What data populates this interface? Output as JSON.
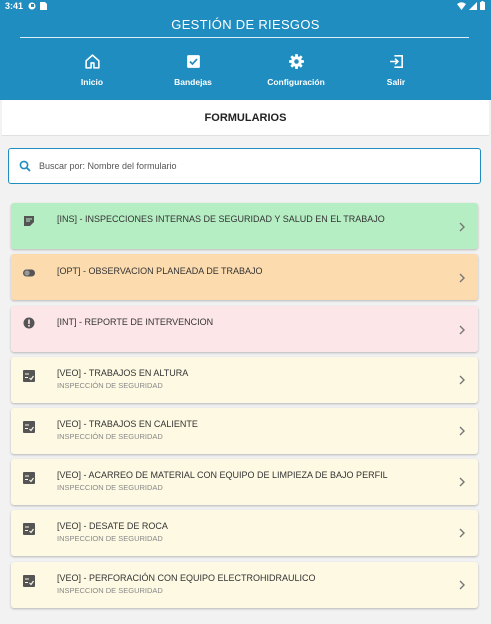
{
  "status_bar": {
    "time": "3:41"
  },
  "app": {
    "title": "GESTIÓN DE RIESGOS"
  },
  "nav": [
    {
      "label": "Inicio",
      "icon": "home-icon"
    },
    {
      "label": "Bandejas",
      "icon": "check-box-icon"
    },
    {
      "label": "Configuración",
      "icon": "gear-icon"
    },
    {
      "label": "Salir",
      "icon": "exit-icon"
    }
  ],
  "section": {
    "title": "FORMULARIOS"
  },
  "search": {
    "placeholder": "Buscar por: Nombre del formulario",
    "value": ""
  },
  "colors": {
    "primary": "#1f8dc0",
    "card_green": "#b6eec4",
    "card_orange": "#fcdcaf",
    "card_pink": "#fde6e8",
    "card_cream": "#fdf9e3"
  },
  "forms": [
    {
      "title": "[INS] - INSPECCIONES INTERNAS DE SEGURIDAD Y SALUD EN EL TRABAJO",
      "subtitle": "",
      "icon": "note-icon",
      "color": "green"
    },
    {
      "title": "[OPT] - OBSERVACION PLANEADA DE TRABAJO",
      "subtitle": "",
      "icon": "toggle-icon",
      "color": "orange"
    },
    {
      "title": "[INT] - REPORTE DE INTERVENCION",
      "subtitle": "",
      "icon": "alert-icon",
      "color": "pink"
    },
    {
      "title": "[VEO] -  TRABAJOS EN ALTURA",
      "subtitle": "INSPECCIÓN DE SEGURIDAD",
      "icon": "checklist-icon",
      "color": "cream"
    },
    {
      "title": "[VEO] -  TRABAJOS EN CALIENTE",
      "subtitle": "INSPECCIÓN DE SEGURIDAD",
      "icon": "checklist-icon",
      "color": "cream"
    },
    {
      "title": "[VEO] - ACARREO DE MATERIAL CON EQUIPO DE LIMPIEZA DE BAJO PERFIL",
      "subtitle": "INSPECCION DE SEGURIDAD",
      "icon": "checklist-icon",
      "color": "cream"
    },
    {
      "title": "[VEO] - DESATE DE ROCA",
      "subtitle": "INSPECCION DE SEGURIDAD",
      "icon": "checklist-icon",
      "color": "cream"
    },
    {
      "title": "[VEO] - PERFORACIÓN CON EQUIPO ELECTROHIDRAULICO",
      "subtitle": "INSPECCION DE SEGURIDAD",
      "icon": "checklist-icon",
      "color": "cream"
    }
  ]
}
